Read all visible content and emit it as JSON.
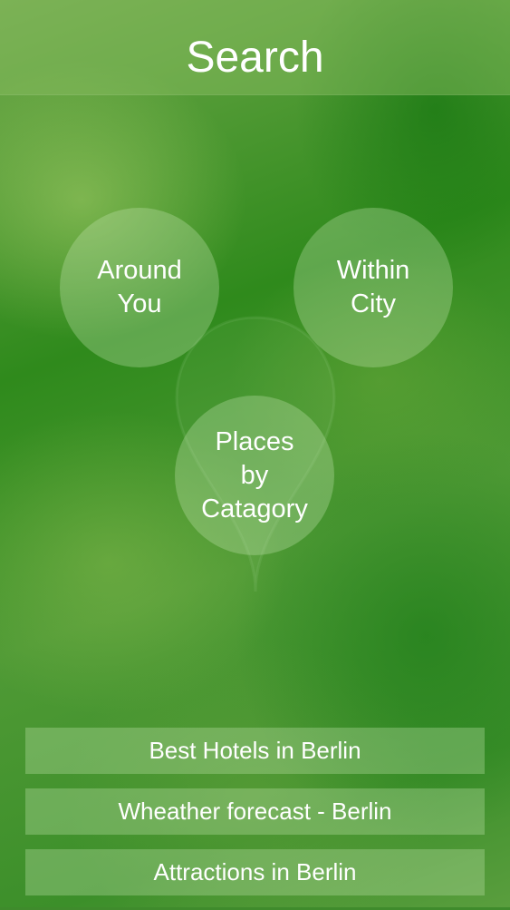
{
  "header": {
    "title": "Search"
  },
  "background": {
    "icon": "location-pin-icon"
  },
  "circles": [
    {
      "label": "Around\nYou"
    },
    {
      "label": "Within\nCity"
    },
    {
      "label": "Places\nby\nCatagory"
    }
  ],
  "list": [
    {
      "label": "Best Hotels in Berlin"
    },
    {
      "label": "Wheather forecast - Berlin"
    },
    {
      "label": "Attractions in Berlin"
    }
  ],
  "colors": {
    "background_green": "#3f8b2c",
    "header_tint": "#8cbe64",
    "text": "#ffffff"
  }
}
